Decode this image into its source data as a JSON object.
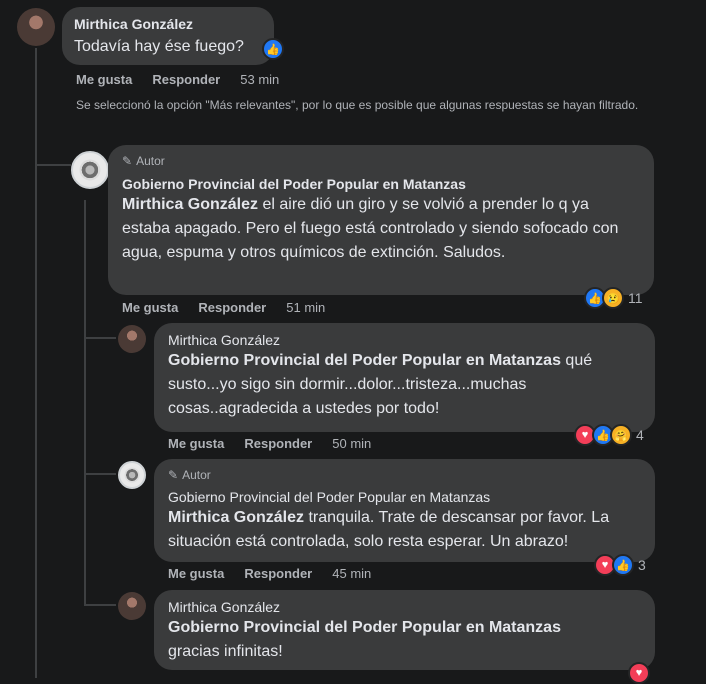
{
  "author_badge": "Autor",
  "top_comment": {
    "name": "Mirthica González",
    "text": "Todavía hay ése fuego?",
    "actions": {
      "like": "Me gusta",
      "reply": "Responder",
      "time": "53 min"
    }
  },
  "notice": "Se seleccionó la opción \"Más relevantes\", por lo que es posible que algunas respuestas se hayan filtrado.",
  "replies": [
    {
      "name": "Gobierno Provincial del Poder Popular en Matanzas",
      "mention": "Mirthica González",
      "text": " el aire dió un giro y se volvió a prender lo q ya estaba apagado. Pero el fuego está controlado y siendo sofocado con agua, espuma y otros químicos de extinción. Saludos.",
      "actions": {
        "like": "Me gusta",
        "reply": "Responder",
        "time": "51 min"
      },
      "reactions": {
        "icons": [
          "like-icon",
          "sad-icon"
        ],
        "count": "11"
      }
    },
    {
      "name": "Mirthica González",
      "mention": "Gobierno Provincial del Poder Popular en Matanzas",
      "text": " qué susto...yo sigo sin dormir...dolor...tristeza...muchas cosas..agradecida a ustedes por todo!",
      "actions": {
        "like": "Me gusta",
        "reply": "Responder",
        "time": "50 min"
      },
      "reactions": {
        "icons": [
          "love-icon",
          "like-icon",
          "care-icon"
        ],
        "count": "4"
      }
    },
    {
      "name": "Gobierno Provincial del Poder Popular en Matanzas",
      "mention": "Mirthica González",
      "text": " tranquila. Trate de descansar por favor. La situación está controlada, solo resta esperar. Un abrazo!",
      "actions": {
        "like": "Me gusta",
        "reply": "Responder",
        "time": "45 min"
      },
      "reactions": {
        "icons": [
          "love-icon",
          "like-icon"
        ],
        "count": "3"
      }
    },
    {
      "name": "Mirthica González",
      "mention": "Gobierno Provincial del Poder Popular en Matanzas",
      "text": "gracias infinitas!",
      "reactions": {
        "icons": [
          "love-icon"
        ]
      }
    }
  ],
  "colors": {
    "background": "#18191a",
    "bubble": "#3a3b3c",
    "like": "#2078f4",
    "love": "#f33e58"
  }
}
